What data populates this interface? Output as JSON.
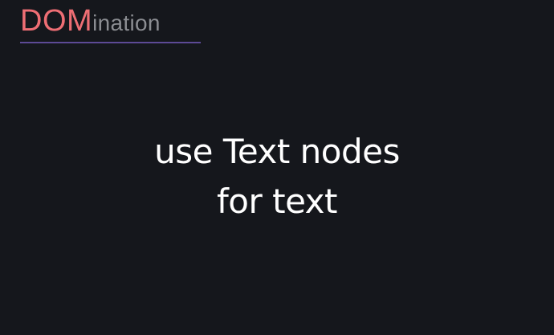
{
  "logo": {
    "strong": "DOM",
    "light": "ination",
    "strong_color": "#ee6e74",
    "light_color": "#8b8d92",
    "underline_color": "#5d4a96"
  },
  "slide": {
    "line1": "use Text nodes",
    "line2": "for text"
  },
  "colors": {
    "background": "#15171c",
    "text": "#ffffff"
  }
}
